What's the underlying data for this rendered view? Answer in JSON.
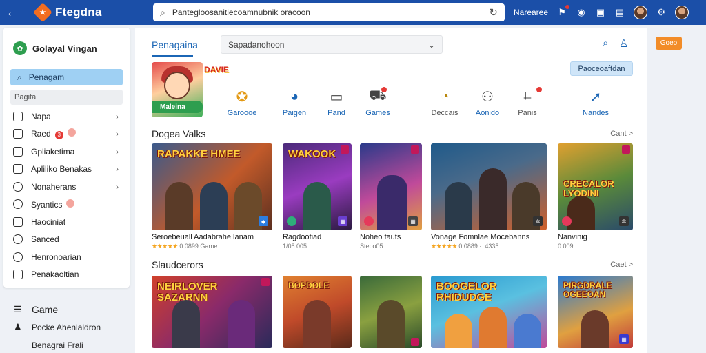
{
  "topbar": {
    "title": "Ftegdna",
    "address_value": "Pantegloosanitiecoamnubnik oracoon",
    "label": "Narearee"
  },
  "sidebar": {
    "title": "Golayal Vingan",
    "active_item": "Penagam",
    "section": "Pagita",
    "items": [
      {
        "label": "Napa",
        "icon": "square-icon"
      },
      {
        "label": "Raed",
        "icon": "square-icon"
      },
      {
        "label": "Gpliaketima",
        "icon": "square-icon"
      },
      {
        "label": "Apliliko Benakas",
        "icon": "square-icon"
      },
      {
        "label": "Nonaherans",
        "icon": "circle-icon"
      },
      {
        "label": "Syantics",
        "icon": "circle-icon"
      },
      {
        "label": "Haociniat",
        "icon": "pin-icon"
      },
      {
        "label": "Sanced",
        "icon": "circle-icon"
      },
      {
        "label": "Henronoarian",
        "icon": "clock-icon"
      },
      {
        "label": "Penakaoltian",
        "icon": "folder-icon"
      }
    ],
    "red_badge": "3"
  },
  "below": {
    "game": "Game",
    "item1": "Pocke Ahenlaldron",
    "item2": "Benagrai Frali"
  },
  "main": {
    "tab": "Penagaina",
    "select_value": "Sapadanohoon",
    "hero_button": "Paoceoaftdan",
    "hero_logo": "DAVIE",
    "hero_badge": "Maleina",
    "categories": [
      {
        "label": "Garoooe",
        "icon": "controller-icon"
      },
      {
        "label": "Paigen",
        "icon": "gamepad-icon"
      },
      {
        "label": "Pand",
        "icon": "tablet-icon"
      },
      {
        "label": "Games",
        "icon": "cart-icon"
      },
      {
        "label": "Deccais",
        "icon": "timer-icon"
      },
      {
        "label": "Aonido",
        "icon": "user-icon"
      },
      {
        "label": "Panis",
        "icon": "tag-icon"
      },
      {
        "label": "Nandes",
        "icon": "arrow-icon"
      }
    ],
    "section1": {
      "title": "Dogea Valks",
      "more": "Cant >"
    },
    "section2": {
      "title": "Slaudcerors",
      "more": "Caet >"
    },
    "cards1": [
      {
        "title": "RAPAKKE HMEE",
        "name": "Seroebeuall Aadabrahe lanam",
        "meta": "0.0899  Garne"
      },
      {
        "title": "WAKOOK",
        "name": "Ragdoofiad",
        "meta": "1/05:005"
      },
      {
        "title": "",
        "name": "Noheo fauts",
        "meta": "Stepo05"
      },
      {
        "title": "",
        "name": "Vonage Fomnlae Mocebanns",
        "meta": "0.0889 · :4335"
      },
      {
        "title": "CRECALOR LYODINI",
        "name": "Nanvinig",
        "meta": "0.009"
      }
    ],
    "cards2": [
      {
        "title": "NEIRLOVER SAZARNN"
      },
      {
        "title": "BOPDOLE"
      },
      {
        "title": ""
      },
      {
        "title": "BOOGELOR RHIDUDGE"
      },
      {
        "title": "PIRGDRALE OGEEOAN"
      }
    ],
    "promo": "Goeo"
  }
}
